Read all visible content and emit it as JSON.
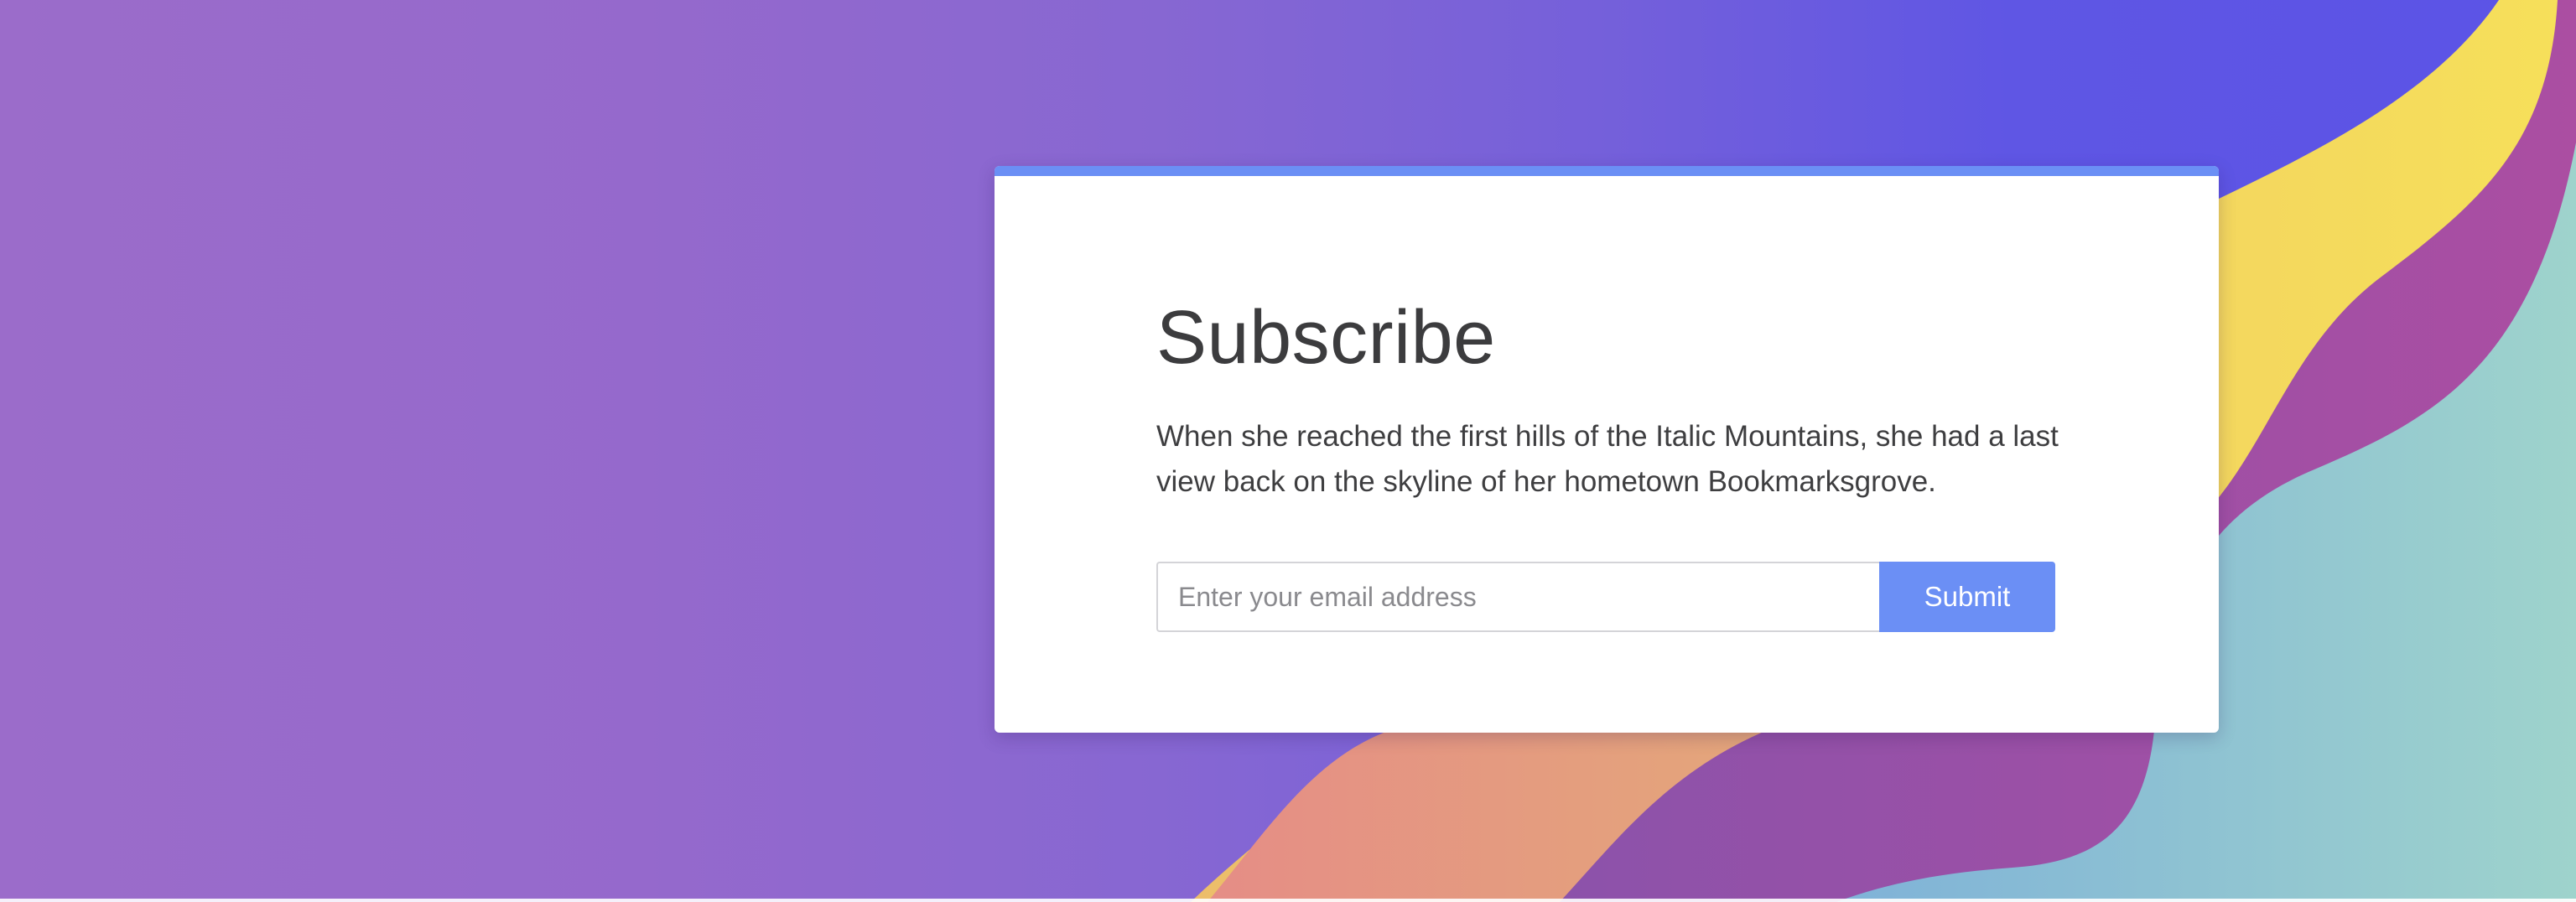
{
  "colors": {
    "accent": "#6b8ff5",
    "background_left": "#9b6cca",
    "background_right": "#5b53e6",
    "wave_yellow": "#f5dd5a",
    "wave_magenta": "#a74ea3",
    "wave_teal": "#8fc8d0",
    "wave_peach": "#e3a07a",
    "card_background": "#ffffff",
    "text": "#3c3c3e"
  },
  "subscribe": {
    "title": "Subscribe",
    "description": "When she reached the first hills of the Italic Mountains, she had a last view back on the skyline of her hometown Bookmarksgrove.",
    "email_placeholder": "Enter your email address",
    "email_value": "",
    "submit_label": "Submit"
  }
}
